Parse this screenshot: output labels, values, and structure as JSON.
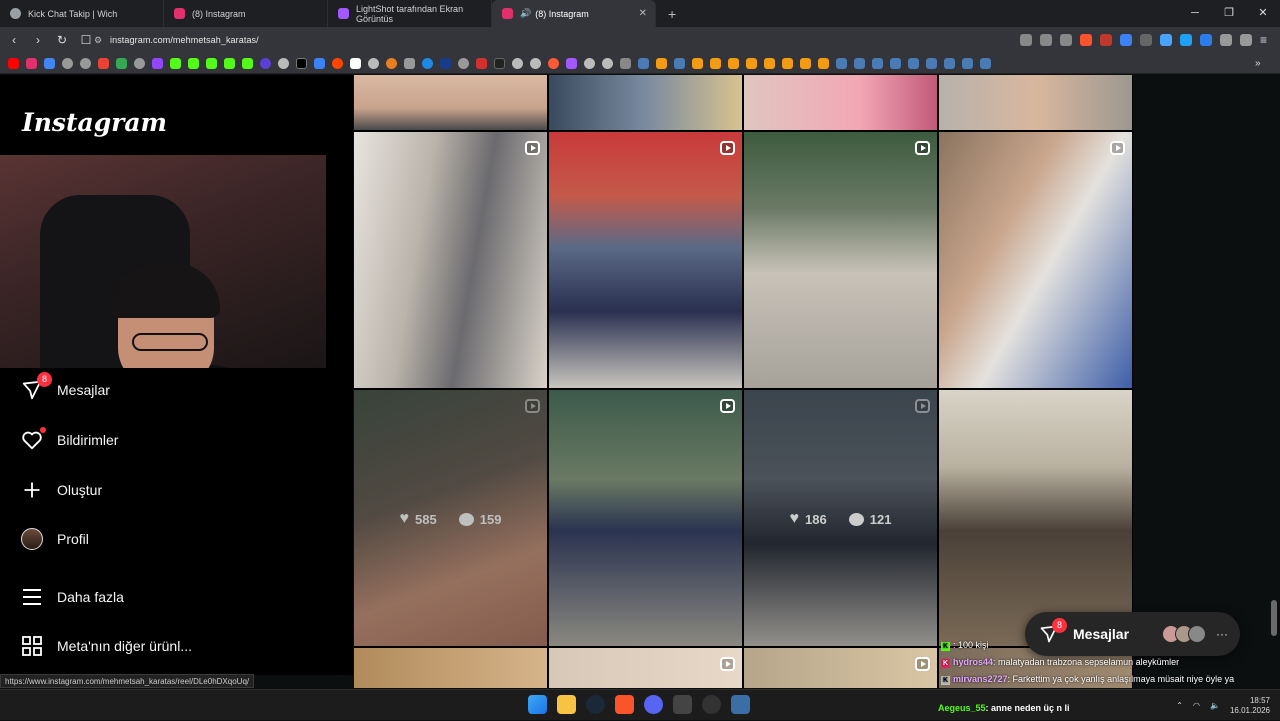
{
  "browser": {
    "tabs": [
      {
        "title": "Kick Chat Takip | Wich",
        "active": false,
        "color": "#9aa0a6"
      },
      {
        "title": "(8) Instagram",
        "active": false,
        "color": "#e1306c"
      },
      {
        "title": "LightShot tarafından Ekran Görüntüs",
        "active": false,
        "color": "#a259ff"
      },
      {
        "title": "(8) Instagram",
        "active": true,
        "color": "#e1306c"
      }
    ],
    "new_tab": "+",
    "url": "instagram.com/mehmetsah_karatas/",
    "status_url": "https://www.instagram.com/mehmetsah_karatas/reel/DLe0hDXqoUq/"
  },
  "sidebar": {
    "logo": "Instagram",
    "items": [
      {
        "label": "Mesajlar",
        "icon": "messenger-icon",
        "badge": "8"
      },
      {
        "label": "Bildirimler",
        "icon": "heart-icon",
        "dot": true
      },
      {
        "label": "Oluştur",
        "icon": "plus-icon"
      },
      {
        "label": "Profil",
        "icon": "avatar"
      },
      {
        "label": "Daha fazla",
        "icon": "menu-icon"
      },
      {
        "label": "Meta'nın diğer ürünl...",
        "icon": "grid-apps-icon"
      }
    ]
  },
  "posts": [
    {
      "stats": null
    },
    {
      "stats": null
    },
    {
      "stats": null
    },
    {
      "stats": null
    },
    {
      "stats": null
    },
    {
      "stats": null
    },
    {
      "stats": null
    },
    {
      "stats": null
    },
    {
      "stats": {
        "likes": "585",
        "comments": "159"
      }
    },
    {
      "stats": null
    },
    {
      "stats": {
        "likes": "186",
        "comments": "121"
      }
    },
    {
      "stats": null
    },
    {
      "stats": null
    },
    {
      "stats": null
    },
    {
      "stats": null
    },
    {
      "stats": null
    }
  ],
  "messages_box": {
    "label": "Mesajlar",
    "badge": "8",
    "more": "···"
  },
  "stream_chat": [
    {
      "user": "",
      "text": ": 100 kişi"
    },
    {
      "user": "hydros44",
      "text": ": malatyadan trabzona sepselamun aleykümler"
    },
    {
      "user": "mirvans2727",
      "text": ": Farkettim ya çok yanlış anlaşılmaya müsait niye öyle ya"
    }
  ],
  "bottom_chat": {
    "user": "Aegeus_55",
    "text": ": anne neden üç n li"
  },
  "clock": {
    "time": "18:57",
    "date": "16.01.2026"
  }
}
